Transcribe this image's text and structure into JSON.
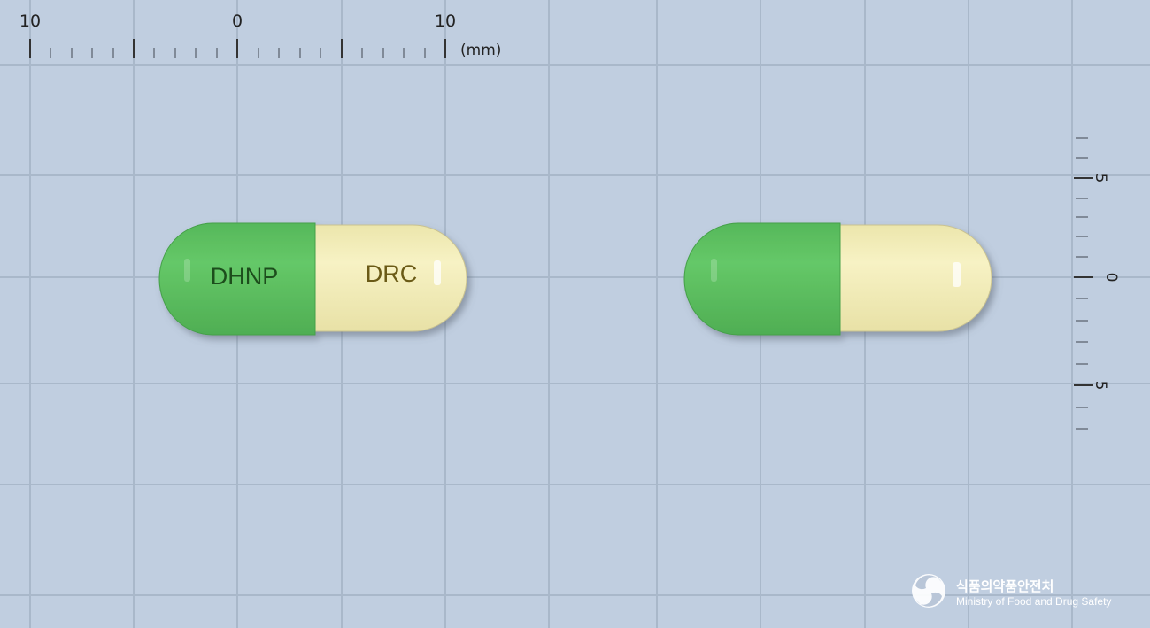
{
  "scale": {
    "top_left_label": "10",
    "top_center_label": "0",
    "top_right_label": "10",
    "unit": "(mm)",
    "right_upper_label": "5",
    "right_center_label": "0",
    "right_lower_label": "5"
  },
  "pill_front": {
    "left_cap_imprint": "DHNP",
    "right_body_imprint": "DRC",
    "cap_color": "#5bbf5e",
    "body_color": "#f3eebb",
    "cap_imprint_color": "#1f4d1c",
    "body_imprint_color": "#6a5a16"
  },
  "pill_back": {
    "cap_color": "#5bbf5e",
    "body_color": "#f3eebb"
  },
  "logo": {
    "korean": "식품의약품안전처",
    "english": "Ministry of Food and Drug Safety"
  },
  "colors": {
    "background": "#c0cee0",
    "grid": "#a7b6c8"
  }
}
